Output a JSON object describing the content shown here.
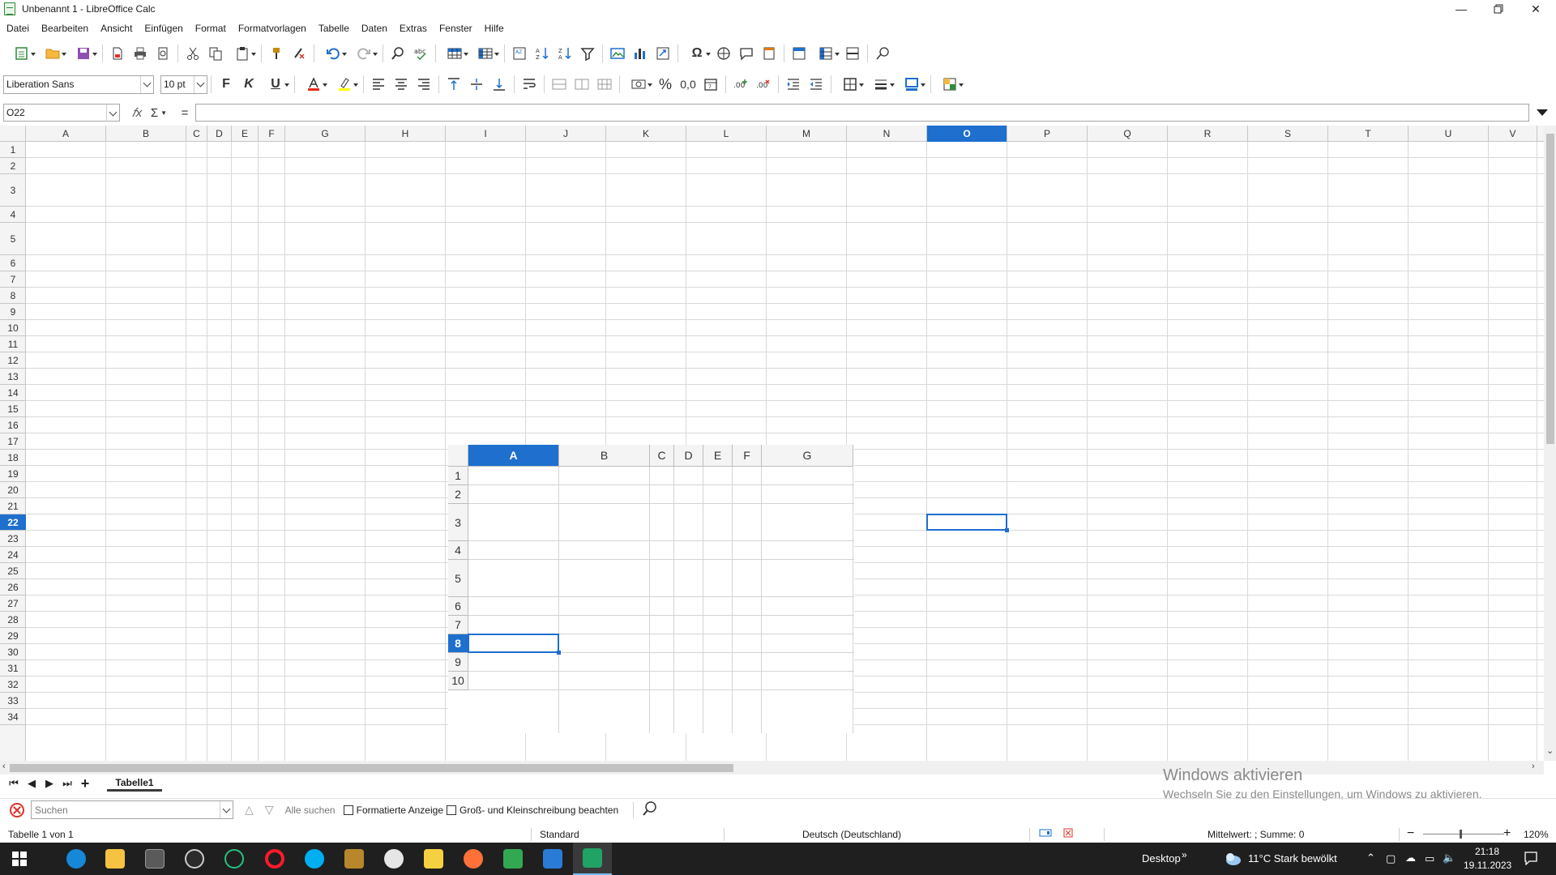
{
  "window": {
    "title": "Unbenannt 1 - LibreOffice Calc"
  },
  "menu": [
    "Datei",
    "Bearbeiten",
    "Ansicht",
    "Einfügen",
    "Format",
    "Formatvorlagen",
    "Tabelle",
    "Daten",
    "Extras",
    "Fenster",
    "Hilfe"
  ],
  "format_toolbar": {
    "font_name": "Liberation Sans",
    "font_size": "10 pt",
    "bold": "F",
    "italic": "K",
    "underline": "U",
    "font_color": "#e8281c",
    "highlight_color": "#ffff00",
    "percent": "%",
    "number": "0,0"
  },
  "formula_bar": {
    "name_box": "O22",
    "fx": "𝑓x",
    "sum": "Σ",
    "equals": "=",
    "content": ""
  },
  "grid": {
    "columns": [
      "A",
      "B",
      "C",
      "D",
      "E",
      "F",
      "G",
      "H",
      "I",
      "J",
      "K",
      "L",
      "M",
      "N",
      "O",
      "P",
      "Q",
      "R",
      "S",
      "T",
      "U",
      "V"
    ],
    "rows": [
      "1",
      "2",
      "3",
      "4",
      "5",
      "6",
      "7",
      "8",
      "9",
      "10",
      "11",
      "12",
      "13",
      "14",
      "15",
      "16",
      "17",
      "18",
      "19",
      "20",
      "21",
      "22",
      "23",
      "24",
      "25",
      "26",
      "27",
      "28",
      "29",
      "30",
      "31",
      "32",
      "33",
      "34"
    ],
    "selected_column": "O",
    "selected_row": "22"
  },
  "mini_sheet": {
    "columns": [
      "A",
      "B",
      "C",
      "D",
      "E",
      "F",
      "G"
    ],
    "rows": [
      "1",
      "2",
      "3",
      "4",
      "5",
      "6",
      "7",
      "8",
      "9",
      "10"
    ],
    "selected_column": "A",
    "selected_row": "8"
  },
  "sheet_tabs": {
    "add": "+",
    "tabs": [
      "Tabelle1"
    ]
  },
  "find_bar": {
    "placeholder": "Suchen",
    "find_all": "Alle suchen",
    "formatted_display": "Formatierte Anzeige",
    "match_case": "Groß- und Kleinschreibung beachten"
  },
  "watermark": {
    "title": "Windows aktivieren",
    "subtitle": "Wechseln Sie zu den Einstellungen, um Windows zu aktivieren."
  },
  "status_bar": {
    "sheet": "Tabelle 1 von 1",
    "style": "Standard",
    "language": "Deutsch (Deutschland)",
    "summary": "Mittelwert: ; Summe: 0",
    "zoom": "120%"
  },
  "taskbar": {
    "desktop": "Desktop",
    "weather": "11°C  Stark bewölkt",
    "time": "21:18",
    "date": "19.11.2023"
  }
}
